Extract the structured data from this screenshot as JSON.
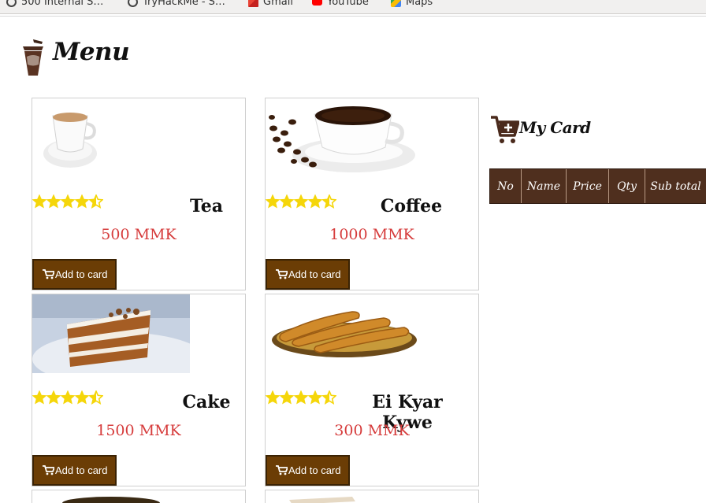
{
  "browser": {
    "bookmarks": [
      {
        "label": "500 Internal S…",
        "icon": "globe-icon"
      },
      {
        "label": "TryHackMe - S…",
        "icon": "globe-icon"
      },
      {
        "label": "Gmail",
        "icon": "gmail-icon"
      },
      {
        "label": "YouTube",
        "icon": "youtube-icon"
      },
      {
        "label": "Maps",
        "icon": "maps-icon"
      }
    ]
  },
  "header": {
    "title": "Menu"
  },
  "products": [
    {
      "name": "Tea",
      "price": "500 MMK",
      "button": "Add to card",
      "rating": 4.5
    },
    {
      "name": "Coffee",
      "price": "1000 MMK",
      "button": "Add to card",
      "rating": 4.5
    },
    {
      "name": "Cake",
      "price": "1500 MMK",
      "button": "Add to card",
      "rating": 4.5
    },
    {
      "name": "Ei Kyar Kywe",
      "price": "300 MMK",
      "button": "Add to card",
      "rating": 4.5
    }
  ],
  "cart": {
    "title": "My Card",
    "columns": [
      "No",
      "Name",
      "Price",
      "Qty",
      "Sub total"
    ]
  },
  "colors": {
    "button_bg": "#6b3d05",
    "price": "#d63c3c",
    "star": "#f5d60a",
    "table_header": "#4f2f1e"
  }
}
